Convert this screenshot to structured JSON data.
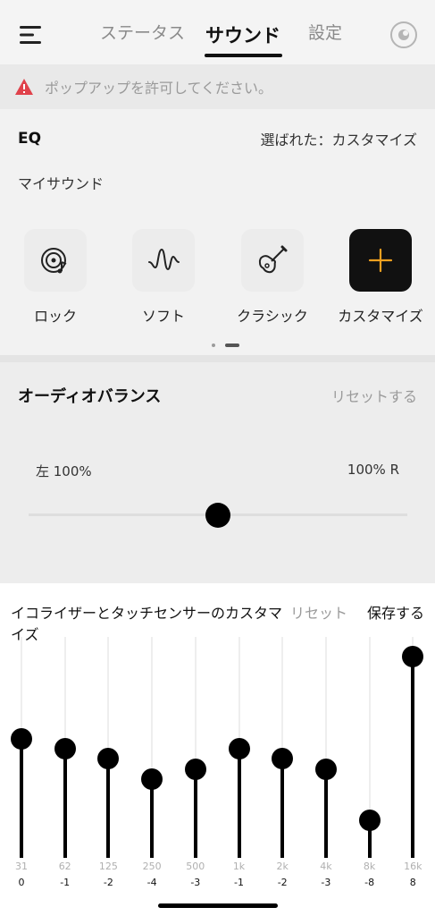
{
  "nav": {
    "tabs": [
      {
        "label": "ステータス",
        "active": false
      },
      {
        "label": "サウンド",
        "active": true
      },
      {
        "label": "設定",
        "active": false
      }
    ]
  },
  "warning": {
    "text": "ポップアップを許可してください。",
    "color": "#e0424b"
  },
  "eq": {
    "title": "EQ",
    "selected": "選ばれた：カスタマイズ",
    "subtitle": "マイサウンド",
    "presets": [
      {
        "label": "ロック",
        "icon": "rock-music-icon"
      },
      {
        "label": "ソフト",
        "icon": "soft-wave-icon"
      },
      {
        "label": "クラシック",
        "icon": "guitar-icon"
      },
      {
        "label": "カスタマイズ",
        "icon": "plus-icon"
      }
    ],
    "accent": "#f0a020"
  },
  "balance": {
    "title": "オーディオバランス",
    "reset": "リセットする",
    "left": "左 100%",
    "right": "100% R",
    "value": 0.5
  },
  "sheet": {
    "title": "イコライザーとタッチセンサーのカスタマイズ",
    "reset": "リセット",
    "save": "保存する",
    "bands": [
      {
        "freq": "31",
        "gain": "0"
      },
      {
        "freq": "62",
        "gain": "-1"
      },
      {
        "freq": "125",
        "gain": "-2"
      },
      {
        "freq": "250",
        "gain": "-4"
      },
      {
        "freq": "500",
        "gain": "-3"
      },
      {
        "freq": "1k",
        "gain": "-1"
      },
      {
        "freq": "2k",
        "gain": "-2"
      },
      {
        "freq": "4k",
        "gain": "-3"
      },
      {
        "freq": "8k",
        "gain": "-8"
      },
      {
        "freq": "16k",
        "gain": "8"
      }
    ]
  }
}
